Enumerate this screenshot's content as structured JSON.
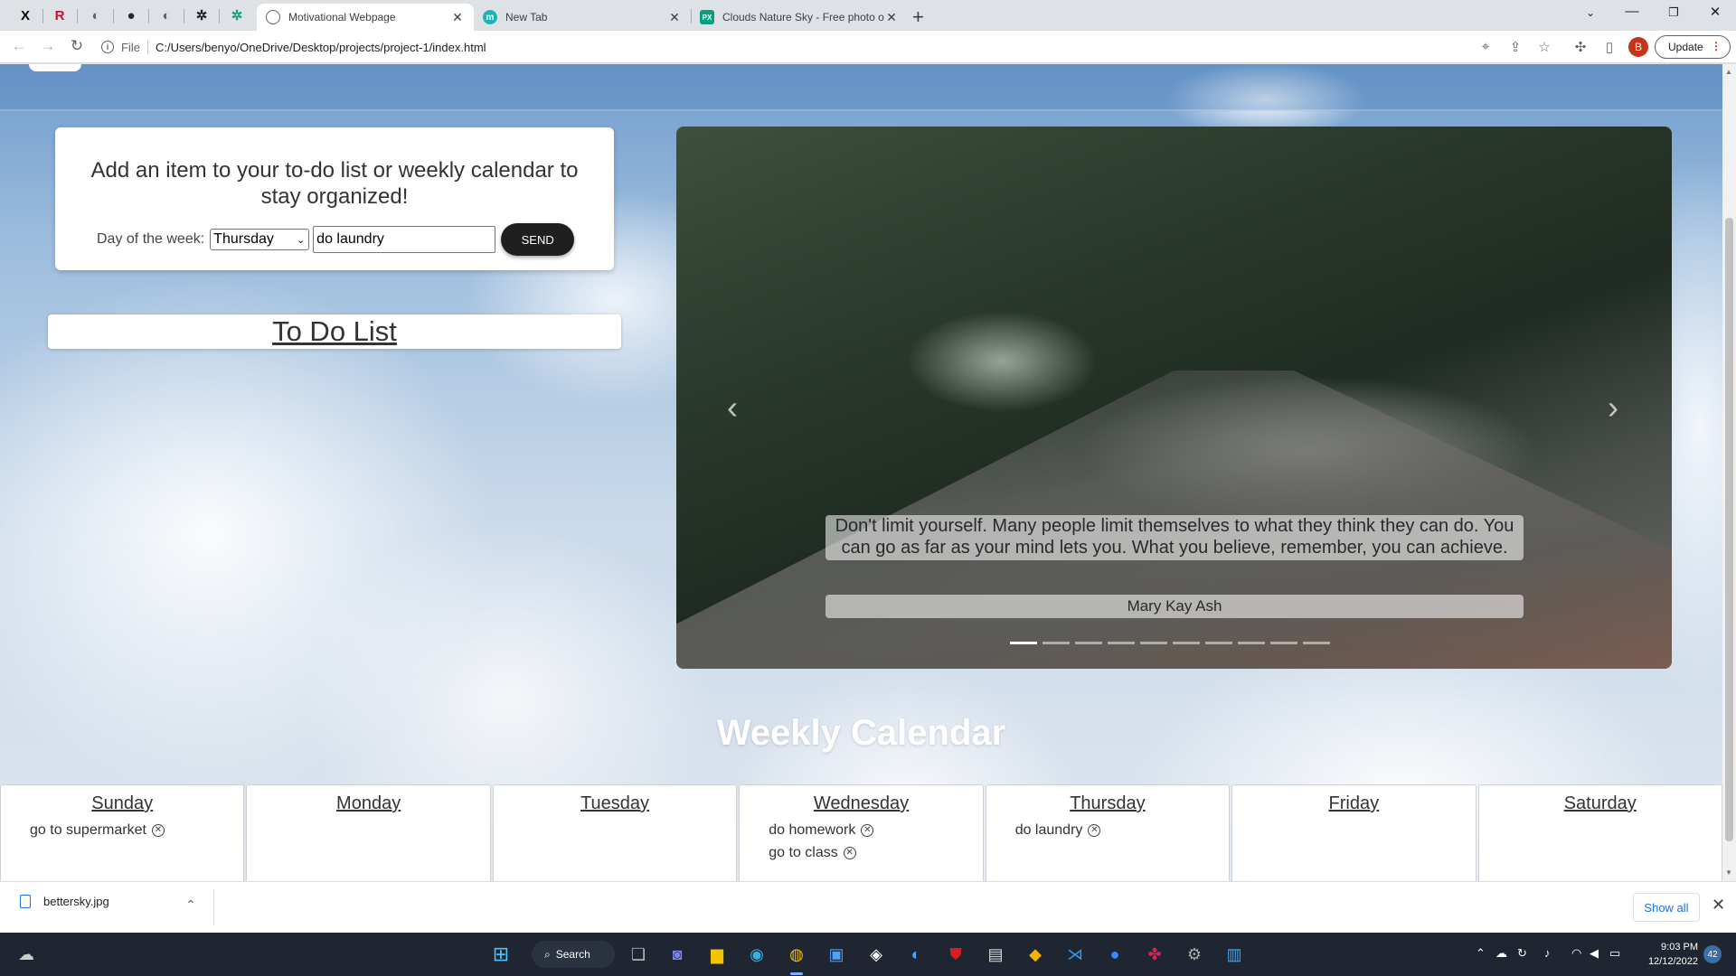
{
  "browser": {
    "pinned_tabs": [
      {
        "icon": "x-icon",
        "glyph": "X",
        "color": "#000000"
      },
      {
        "icon": "r-icon",
        "glyph": "R",
        "color": "#c8102e"
      },
      {
        "icon": "globe-icon",
        "glyph": "◐",
        "color": "#5f6368"
      },
      {
        "icon": "github-icon",
        "glyph": "●",
        "color": "#24292e"
      },
      {
        "icon": "globe-icon",
        "glyph": "◐",
        "color": "#5f6368"
      },
      {
        "icon": "openai-icon",
        "glyph": "✲",
        "color": "#202124"
      },
      {
        "icon": "chatgpt-icon",
        "glyph": "✲",
        "color": "#10a37f"
      }
    ],
    "tabs": [
      {
        "title": "Motivational Webpage",
        "active": true,
        "favicon": "globe-icon",
        "fav_color": "#5f6368",
        "fav_glyph": ""
      },
      {
        "title": "New Tab",
        "active": false,
        "favicon": "m-icon",
        "fav_color": "#1bb5b5",
        "fav_glyph": "m"
      },
      {
        "title": "Clouds Nature Sky - Free photo o",
        "active": false,
        "favicon": "px-icon",
        "fav_color": "#05a081",
        "fav_glyph": "PX"
      }
    ],
    "new_tab": "+",
    "address": {
      "scheme": "File",
      "url": "C:/Users/benyo/OneDrive/Desktop/projects/project-1/index.html"
    },
    "profile_initial": "B",
    "update_label": "Update"
  },
  "page": {
    "add_form": {
      "heading": "Add an item to your to-do list or weekly calendar to stay organized!",
      "day_label": "Day of the week:",
      "day_value": "Thursday",
      "task_value": "do laundry",
      "send_label": "SEND"
    },
    "todo_heading": "To Do List",
    "carousel": {
      "quote": "Don't limit yourself. Many people limit themselves to what they think they can do. You can go as far as your mind lets you. What you believe, remember, you can achieve.",
      "author": "Mary Kay Ash",
      "slide_count": 10,
      "active_slide": 1
    },
    "calendar_heading": "Weekly Calendar",
    "days": [
      {
        "name": "Sunday",
        "tasks": [
          "go to supermarket"
        ]
      },
      {
        "name": "Monday",
        "tasks": []
      },
      {
        "name": "Tuesday",
        "tasks": []
      },
      {
        "name": "Wednesday",
        "tasks": [
          "do homework",
          "go to class"
        ]
      },
      {
        "name": "Thursday",
        "tasks": [
          "do laundry"
        ]
      },
      {
        "name": "Friday",
        "tasks": []
      },
      {
        "name": "Saturday",
        "tasks": []
      }
    ],
    "remove_glyph": "✕"
  },
  "downloads": {
    "file_name": "bettersky.jpg",
    "show_all": "Show all"
  },
  "taskbar": {
    "search_label": "Search",
    "time": "9:03 PM",
    "date": "12/12/2022",
    "notification_count": "42"
  }
}
